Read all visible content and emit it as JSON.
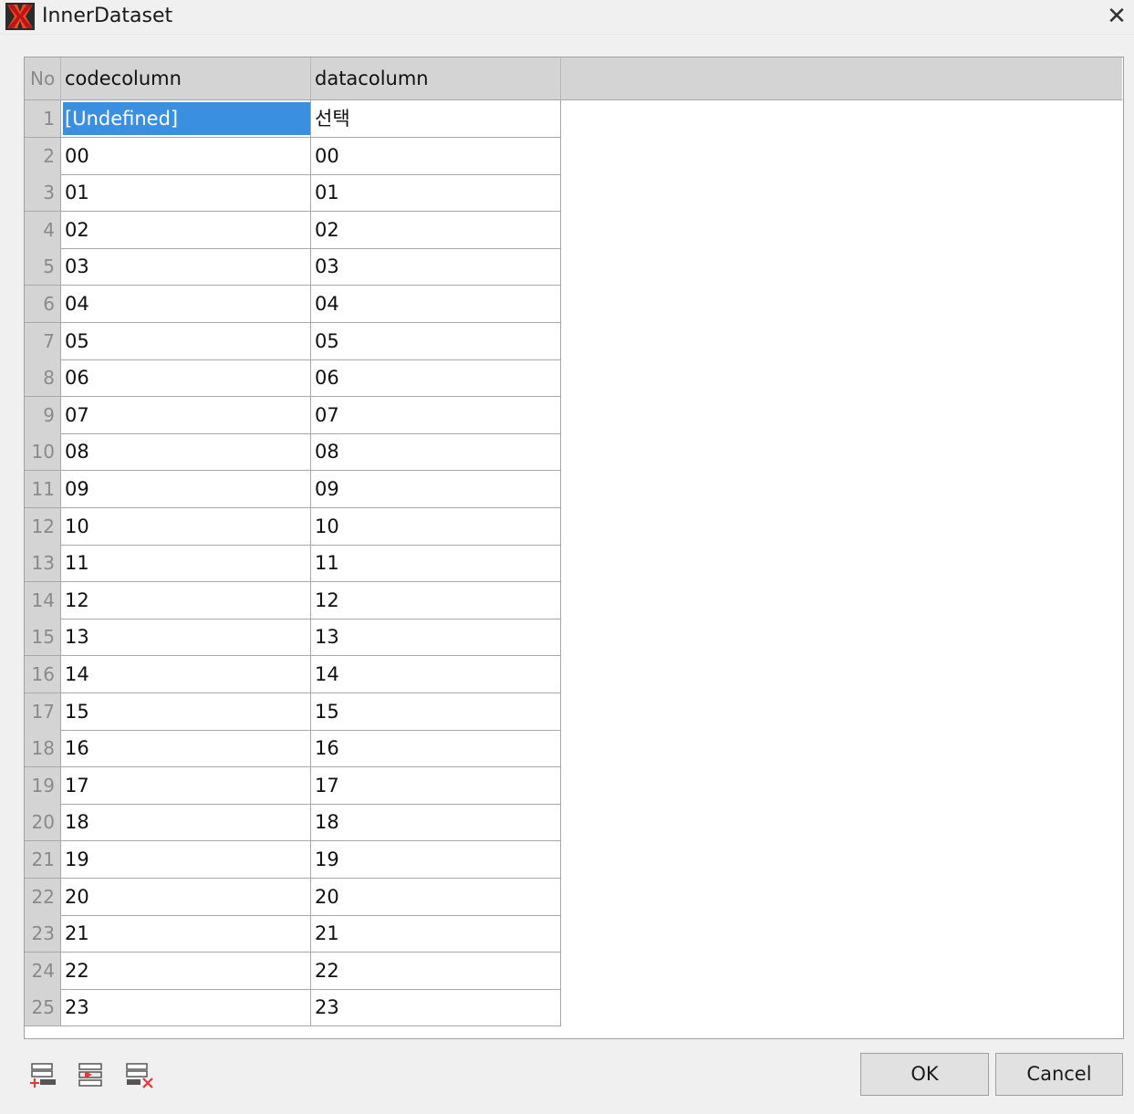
{
  "window": {
    "title": "InnerDataset",
    "close_glyph": "✕"
  },
  "grid": {
    "headers": {
      "no": "No",
      "code": "codecolumn",
      "data": "datacolumn"
    },
    "selected_row": 0,
    "rows": [
      {
        "no": "1",
        "code": "[Undefined]",
        "data": "선택"
      },
      {
        "no": "2",
        "code": "00",
        "data": "00"
      },
      {
        "no": "3",
        "code": "01",
        "data": "01"
      },
      {
        "no": "4",
        "code": "02",
        "data": "02"
      },
      {
        "no": "5",
        "code": "03",
        "data": "03"
      },
      {
        "no": "6",
        "code": "04",
        "data": "04"
      },
      {
        "no": "7",
        "code": "05",
        "data": "05"
      },
      {
        "no": "8",
        "code": "06",
        "data": "06"
      },
      {
        "no": "9",
        "code": "07",
        "data": "07"
      },
      {
        "no": "10",
        "code": "08",
        "data": "08"
      },
      {
        "no": "11",
        "code": "09",
        "data": "09"
      },
      {
        "no": "12",
        "code": "10",
        "data": "10"
      },
      {
        "no": "13",
        "code": "11",
        "data": "11"
      },
      {
        "no": "14",
        "code": "12",
        "data": "12"
      },
      {
        "no": "15",
        "code": "13",
        "data": "13"
      },
      {
        "no": "16",
        "code": "14",
        "data": "14"
      },
      {
        "no": "17",
        "code": "15",
        "data": "15"
      },
      {
        "no": "18",
        "code": "16",
        "data": "16"
      },
      {
        "no": "19",
        "code": "17",
        "data": "17"
      },
      {
        "no": "20",
        "code": "18",
        "data": "18"
      },
      {
        "no": "21",
        "code": "19",
        "data": "19"
      },
      {
        "no": "22",
        "code": "20",
        "data": "20"
      },
      {
        "no": "23",
        "code": "21",
        "data": "21"
      },
      {
        "no": "24",
        "code": "22",
        "data": "22"
      },
      {
        "no": "25",
        "code": "23",
        "data": "23"
      }
    ]
  },
  "toolbar": {
    "icons": [
      "add-row-icon",
      "insert-row-icon",
      "delete-row-icon"
    ]
  },
  "buttons": {
    "ok": "OK",
    "cancel": "Cancel"
  },
  "colors": {
    "selection": "#3b8fe0",
    "header_bg": "#d4d4d4",
    "window_bg": "#f0f0f0"
  }
}
